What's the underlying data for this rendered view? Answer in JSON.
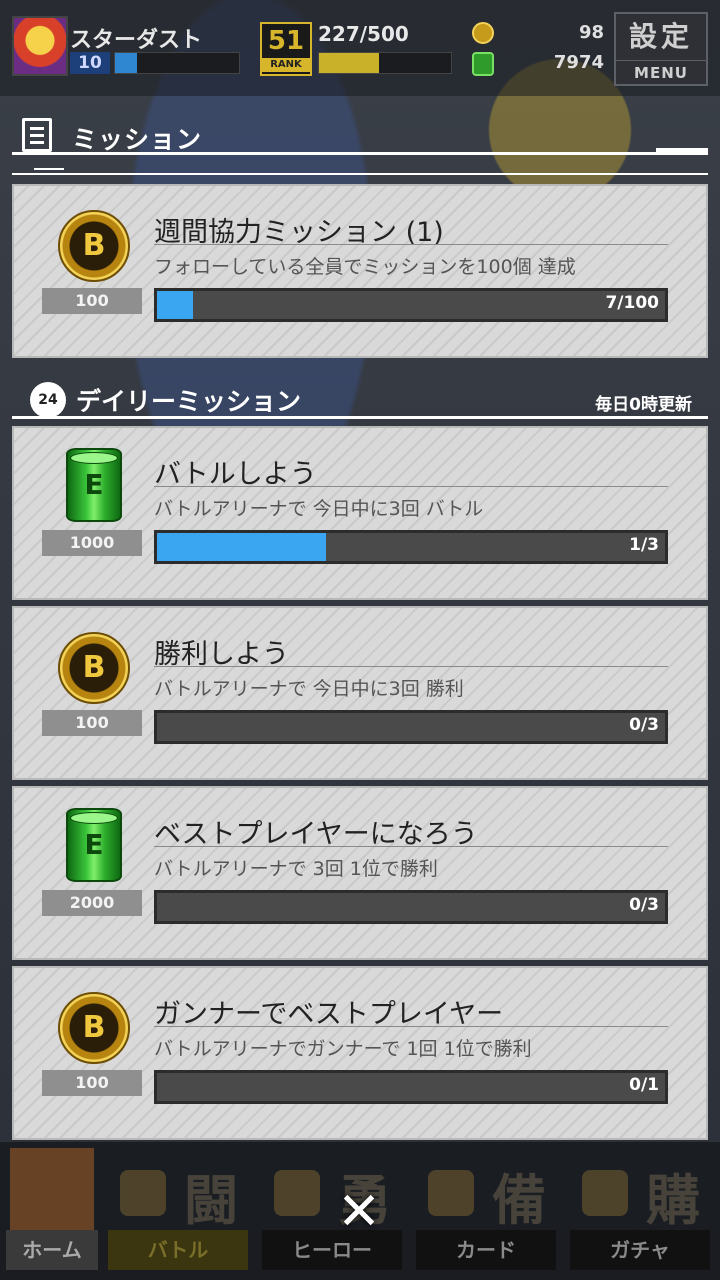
{
  "header": {
    "player_name": "スターダスト",
    "level": "10",
    "exp_fraction": 0.18,
    "rank": "51",
    "rank_label": "RANK",
    "stamina": "227/500",
    "stamina_fraction": 0.454,
    "coins": "98",
    "gems": "7974",
    "menu_kanji": "設定",
    "menu_label": "MENU"
  },
  "section": {
    "title": "ミッション"
  },
  "weekly": {
    "title": "週間協力ミッション (1)",
    "description": "フォローしている全員でミッションを100個 達成",
    "reward_icon": "coin-icon",
    "reward_amount": "100",
    "progress_text": "7/100",
    "progress_fraction": 0.07
  },
  "daily": {
    "icon_text": "24",
    "title": "デイリーミッション",
    "reset_note": "毎日0時更新",
    "missions": [
      {
        "title": "バトルしよう",
        "description": "バトルアリーナで 今日中に3回 バトル",
        "reward_icon": "barrel-icon",
        "reward_amount": "1000",
        "progress_text": "1/3",
        "progress_fraction": 0.333
      },
      {
        "title": "勝利しよう",
        "description": "バトルアリーナで 今日中に3回 勝利",
        "reward_icon": "coin-icon",
        "reward_amount": "100",
        "progress_text": "0/3",
        "progress_fraction": 0
      },
      {
        "title": "ベストプレイヤーになろう",
        "description": "バトルアリーナで 3回 1位で勝利",
        "reward_icon": "barrel-icon",
        "reward_amount": "2000",
        "progress_text": "0/3",
        "progress_fraction": 0
      },
      {
        "title": "ガンナーでベストプレイヤー",
        "description": "バトルアリーナでガンナーで 1回 1位で勝利",
        "reward_icon": "coin-icon",
        "reward_amount": "100",
        "progress_text": "0/1",
        "progress_fraction": 0
      }
    ]
  },
  "nav": {
    "items": [
      {
        "label": "ホーム",
        "kanji": ""
      },
      {
        "label": "バトル",
        "kanji": "闘"
      },
      {
        "label": "ヒーロー",
        "kanji": "勇"
      },
      {
        "label": "カード",
        "kanji": "備"
      },
      {
        "label": "ガチャ",
        "kanji": "購"
      }
    ],
    "close_symbol": "✕"
  },
  "colors": {
    "progress_fill": "#3aa6f2",
    "card_bg": "#d9d9d9",
    "accent_gold": "#d8b62b"
  }
}
